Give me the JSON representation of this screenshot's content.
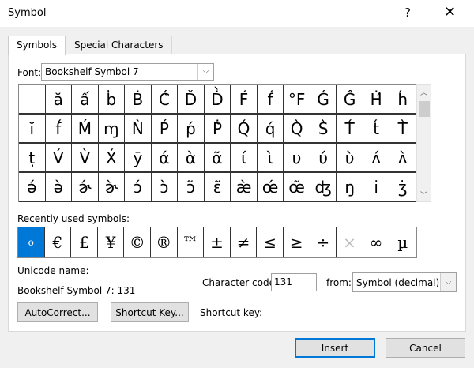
{
  "window": {
    "title": "Symbol",
    "help": "?",
    "close": "✕"
  },
  "tabs": [
    {
      "label": "Symbols"
    },
    {
      "label": "Special Characters"
    }
  ],
  "font": {
    "label": "Font:",
    "value": "Bookshelf Symbol 7"
  },
  "symbols": [
    "",
    "ă",
    "ấ",
    "ḃ",
    "Ḃ",
    "Ć̀",
    "Ď",
    "Ḋ̀",
    "F́",
    "f́",
    "°F",
    "Ǵ",
    "Ĝ̀",
    "Ḣ́",
    "h́",
    "ĭ",
    "f́",
    "Ḿ",
    "ɱ",
    "Ǹ",
    "Ṕ",
    "ṕ",
    "Ṗ̀",
    "Q́",
    "q́",
    "Q̀",
    "S̀",
    "T́",
    "t́",
    "T̀",
    "ṭ",
    "V́",
    "V̀",
    "X́",
    "ȳ",
    "ά",
    "ὰ",
    "ᾶ",
    "ί",
    "ὶ",
    "υ",
    "ύ",
    "ὺ",
    "ʌ́",
    "ʌ̀",
    "ə́",
    "ə̀",
    "ɚ́",
    "ɚ̀",
    "ɔ́",
    "ɔ̀",
    "ɔ̃",
    "ɛ̃",
    "æ̀",
    "œ́",
    "œ̃",
    "ʤ",
    "ŋ",
    "i̇",
    "ʒ̇"
  ],
  "recent": {
    "label": "Recently used symbols:",
    "items": [
      "o",
      "€",
      "£",
      "¥",
      "©",
      "®",
      "™",
      "±",
      "≠",
      "≤",
      "≥",
      "÷",
      "×",
      "∞",
      "µ"
    ]
  },
  "unicode_name": {
    "label": "Unicode name:",
    "value": "Bookshelf Symbol 7: 131"
  },
  "char_code": {
    "label": "Character code:",
    "value": "131"
  },
  "from": {
    "label": "from:",
    "value": "Symbol (decimal)"
  },
  "buttons": {
    "autocorrect": "AutoCorrect...",
    "shortcut_key": "Shortcut Key...",
    "insert": "Insert",
    "cancel": "Cancel"
  },
  "shortcut_key_label": "Shortcut key:"
}
